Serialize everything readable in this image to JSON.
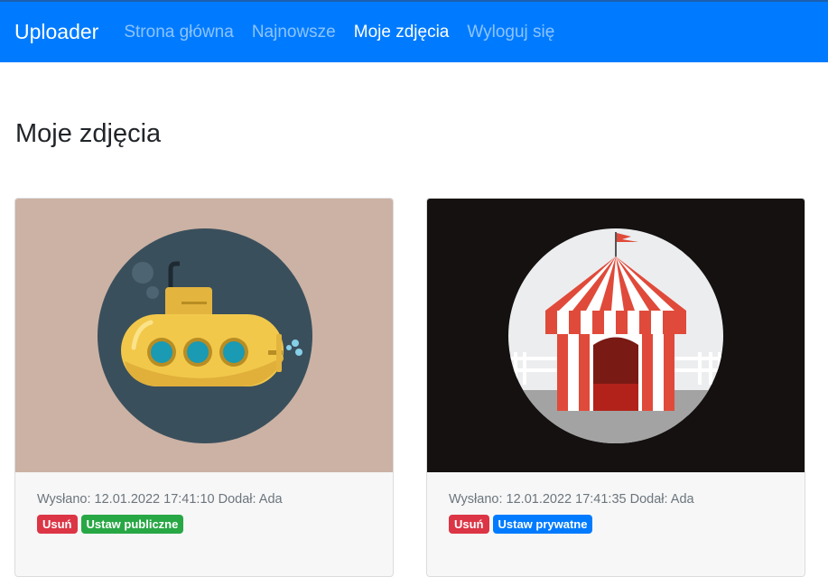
{
  "navbar": {
    "brand": "Uploader",
    "links": [
      "Strona główna",
      "Najnowsze",
      "Moje zdjęcia",
      "Wyloguj się"
    ],
    "active_index": 2
  },
  "page": {
    "title": "Moje zdjęcia"
  },
  "photos": [
    {
      "uploaded_label": "Wysłano:",
      "uploaded_at": "12.01.2022 17:41:10",
      "author_label": "Dodał:",
      "author": "Ada",
      "delete_label": "Usuń",
      "visibility_label": "Ustaw publiczne",
      "bg_color": "#cbb2a4"
    },
    {
      "uploaded_label": "Wysłano:",
      "uploaded_at": "12.01.2022 17:41:35",
      "author_label": "Dodał:",
      "author": "Ada",
      "delete_label": "Usuń",
      "visibility_label": "Ustaw prywatne",
      "bg_color": "#141110"
    }
  ],
  "colors": {
    "navbar": "#007bff",
    "danger": "#dc3545",
    "success": "#28a745",
    "primary": "#007bff"
  }
}
